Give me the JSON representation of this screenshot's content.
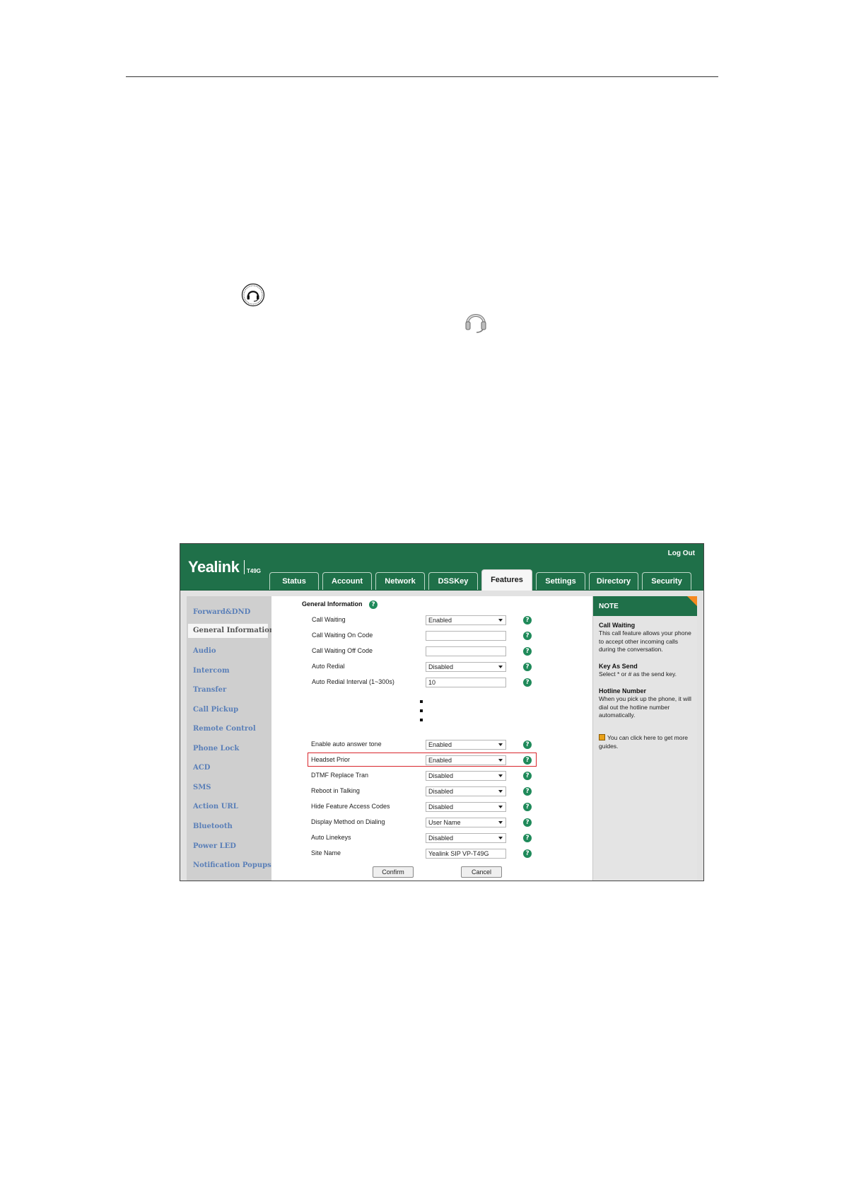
{
  "window": {
    "brand": "Yealink",
    "model": "T49G",
    "logout_label": "Log Out"
  },
  "tabs": [
    {
      "label": "Status"
    },
    {
      "label": "Account"
    },
    {
      "label": "Network"
    },
    {
      "label": "DSSKey"
    },
    {
      "label": "Features",
      "active": true
    },
    {
      "label": "Settings"
    },
    {
      "label": "Directory"
    },
    {
      "label": "Security"
    }
  ],
  "sidebar": {
    "items": [
      {
        "label": "Forward&DND"
      },
      {
        "label": "General Information",
        "active": true
      },
      {
        "label": "Audio"
      },
      {
        "label": "Intercom"
      },
      {
        "label": "Transfer"
      },
      {
        "label": "Call Pickup"
      },
      {
        "label": "Remote Control"
      },
      {
        "label": "Phone Lock"
      },
      {
        "label": "ACD"
      },
      {
        "label": "SMS"
      },
      {
        "label": "Action URL"
      },
      {
        "label": "Bluetooth"
      },
      {
        "label": "Power LED"
      },
      {
        "label": "Notification Popups"
      }
    ]
  },
  "main": {
    "section_title": "General Information",
    "rows_top": [
      {
        "label": "Call Waiting",
        "value": "Enabled",
        "type": "select"
      },
      {
        "label": "Call Waiting On Code",
        "value": "",
        "type": "input"
      },
      {
        "label": "Call Waiting Off Code",
        "value": "",
        "type": "input"
      },
      {
        "label": "Auto Redial",
        "value": "Disabled",
        "type": "select"
      },
      {
        "label": "Auto Redial Interval (1~300s)",
        "value": "10",
        "type": "input"
      }
    ],
    "rows_bottom": [
      {
        "label": "Enable auto answer tone",
        "value": "Enabled",
        "type": "select"
      },
      {
        "label": "Headset Prior",
        "value": "Enabled",
        "type": "select",
        "highlighted": true
      },
      {
        "label": "DTMF Replace Tran",
        "value": "Disabled",
        "type": "select"
      },
      {
        "label": "Reboot in Talking",
        "value": "Disabled",
        "type": "select"
      },
      {
        "label": "Hide Feature Access Codes",
        "value": "Disabled",
        "type": "select"
      },
      {
        "label": "Display Method on Dialing",
        "value": "User Name",
        "type": "select"
      },
      {
        "label": "Auto Linekeys",
        "value": "Disabled",
        "type": "select"
      },
      {
        "label": "Site Name",
        "value": "Yealink SIP VP-T49G",
        "type": "input"
      }
    ],
    "confirm_label": "Confirm",
    "cancel_label": "Cancel"
  },
  "note": {
    "title": "NOTE",
    "sections": [
      {
        "heading": "Call Waiting",
        "text": "This call feature allows your phone to accept other incoming calls during the conversation."
      },
      {
        "heading": "Key As Send",
        "text": "Select * or # as the send key."
      },
      {
        "heading": "Hotline Number",
        "text": "When you pick up the phone, it will dial out the hotline number automatically."
      }
    ],
    "guide_text": "You can click here to get more guides."
  },
  "colors": {
    "header_green": "#1f7049",
    "highlight_red": "#d9262c",
    "note_corner": "#f5891f",
    "sidebar_link": "#5a7fb8"
  },
  "icons": {
    "headset_key": "headset-round-icon",
    "headset_status": "headset-icon"
  }
}
